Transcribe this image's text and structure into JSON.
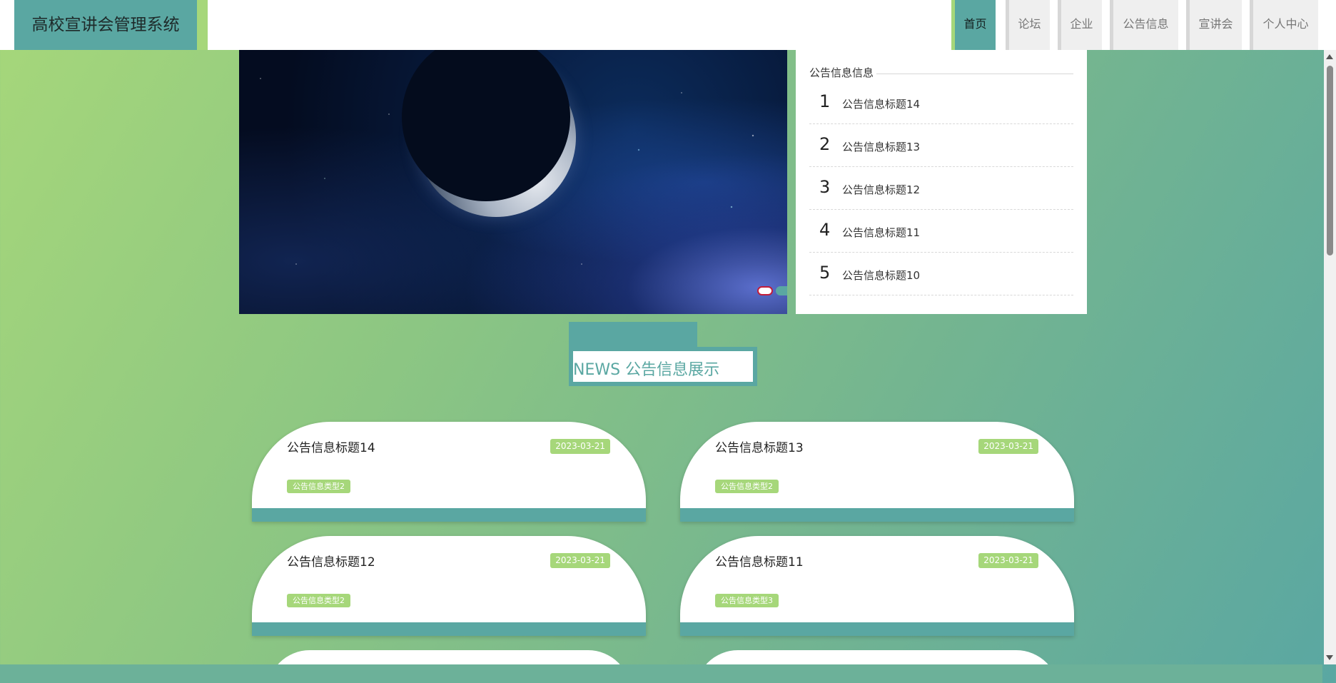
{
  "header": {
    "title": "高校宣讲会管理系统",
    "nav": [
      {
        "label": "首页",
        "active": true
      },
      {
        "label": "论坛",
        "active": false
      },
      {
        "label": "企业",
        "active": false
      },
      {
        "label": "公告信息",
        "active": false
      },
      {
        "label": "宣讲会",
        "active": false
      },
      {
        "label": "个人中心",
        "active": false
      }
    ]
  },
  "colors": {
    "primary": "#5aa7a2",
    "accent": "#a6d77a",
    "indicator_border": "#c21d3a"
  },
  "carousel": {
    "image": "space-moon-banner",
    "slides": 3,
    "active_index": 1
  },
  "notice_panel": {
    "title": "公告信息信息",
    "items": [
      {
        "num": "1",
        "title": "公告信息标题14"
      },
      {
        "num": "2",
        "title": "公告信息标题13"
      },
      {
        "num": "3",
        "title": "公告信息标题12"
      },
      {
        "num": "4",
        "title": "公告信息标题11"
      },
      {
        "num": "5",
        "title": "公告信息标题10"
      }
    ]
  },
  "section": {
    "title": "NEWS 公告信息展示"
  },
  "news_cards": [
    {
      "title": "公告信息标题14",
      "date": "2023-03-21",
      "type": "公告信息类型2"
    },
    {
      "title": "公告信息标题13",
      "date": "2023-03-21",
      "type": "公告信息类型2"
    },
    {
      "title": "公告信息标题12",
      "date": "2023-03-21",
      "type": "公告信息类型2"
    },
    {
      "title": "公告信息标题11",
      "date": "2023-03-21",
      "type": "公告信息类型3"
    }
  ]
}
